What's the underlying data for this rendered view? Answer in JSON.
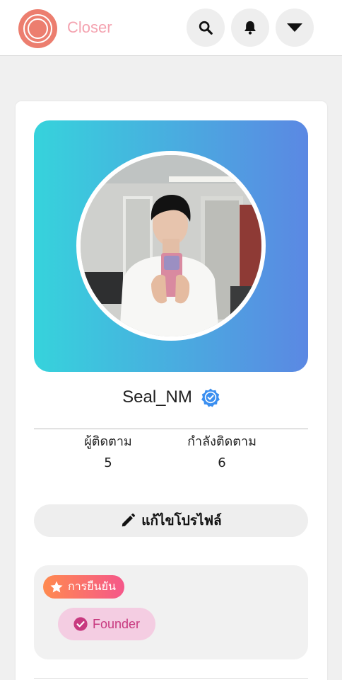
{
  "header": {
    "brand": "Closer",
    "icons": [
      "search-icon",
      "bell-icon",
      "caret-down-icon"
    ]
  },
  "profile": {
    "username": "Seal_NM",
    "verified": true,
    "followers_label": "ผู้ติดตาม",
    "followers_count": "5",
    "following_label": "กำลังติดตาม",
    "following_count": "6",
    "edit_label": "แก้ไขโปรไฟล์"
  },
  "badges": {
    "section_label": "การยืนยัน",
    "items": [
      {
        "label": "Founder"
      }
    ]
  },
  "colors": {
    "brand": "#f4a3b0",
    "logo": "#ec7e6f",
    "cover_start": "#36d3dc",
    "cover_end": "#5b88e3",
    "verified_badge": "#3b8ff0",
    "chip_start": "#ff8a4f",
    "chip_end": "#f5578a",
    "founder_text": "#c8397f",
    "founder_bg": "#f4cde2"
  }
}
